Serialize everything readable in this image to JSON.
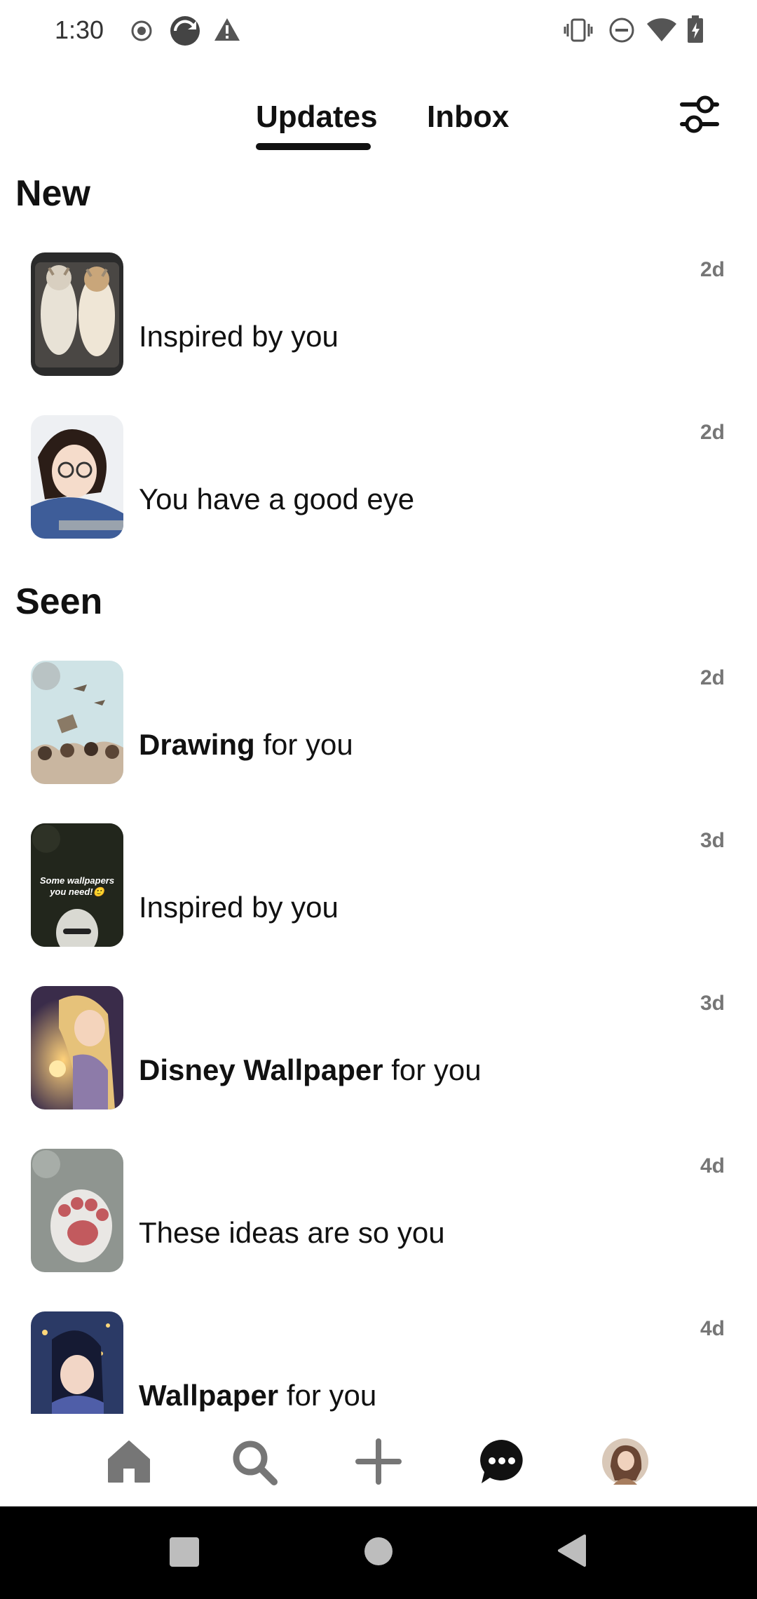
{
  "status_bar": {
    "time": "1:30",
    "icons_left": [
      "record-icon",
      "sync-app-icon",
      "warning-icon"
    ],
    "icons_right": [
      "vibrate-icon",
      "do-not-disturb-icon",
      "wifi-icon",
      "battery-charging-icon"
    ]
  },
  "header": {
    "tabs": [
      {
        "label": "Updates",
        "active": true
      },
      {
        "label": "Inbox",
        "active": false
      }
    ],
    "filter_icon": "filter-sliders-icon"
  },
  "sections": {
    "new_title": "New",
    "seen_title": "Seen"
  },
  "notifications": [
    {
      "bold": "",
      "text": "Inspired by you",
      "age": "2d",
      "thumb": "cats-photo"
    },
    {
      "bold": "",
      "text": "You have a good eye",
      "age": "2d",
      "thumb": "girl-laptop-illustration"
    },
    {
      "bold": "Drawing",
      "text": " for you",
      "age": "2d",
      "thumb": "graduation-drawing"
    },
    {
      "bold": "",
      "text": "Inspired by you",
      "age": "3d",
      "thumb": "dark-wallpaper",
      "thumb_caption": "Some wallpapers you need!🙂"
    },
    {
      "bold": "Disney Wallpaper",
      "text": " for you",
      "age": "3d",
      "thumb": "rapunzel-lantern"
    },
    {
      "bold": "",
      "text": "These ideas are so you",
      "age": "4d",
      "thumb": "cat-paw-glass"
    },
    {
      "bold": "Wallpaper",
      "text": " for you",
      "age": "4d",
      "thumb": "night-girl-illustration"
    }
  ],
  "bottom_nav": [
    "home-icon",
    "search-icon",
    "create-icon",
    "messages-icon",
    "profile-avatar"
  ],
  "system_nav": [
    "recents-icon",
    "home-circle-icon",
    "back-icon"
  ],
  "colors": {
    "text": "#111111",
    "muted": "#767676",
    "background": "#ffffff"
  }
}
